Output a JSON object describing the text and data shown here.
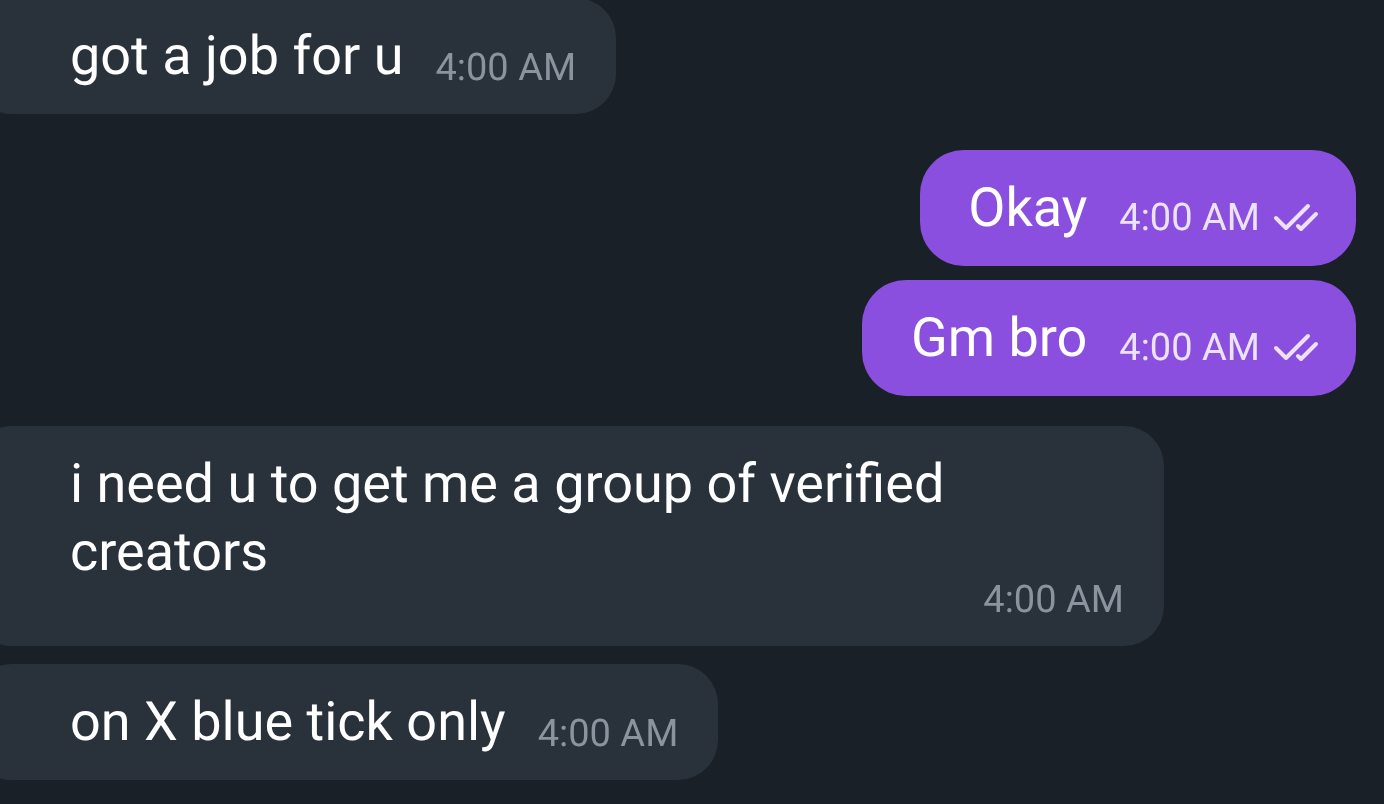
{
  "messages": [
    {
      "kind": "incoming",
      "text": "got a job for u",
      "time": "4:00 AM"
    },
    {
      "kind": "outgoing",
      "text": "Okay",
      "time": "4:00 AM",
      "read": true
    },
    {
      "kind": "outgoing",
      "text": "Gm bro",
      "time": "4:00 AM",
      "read": true
    },
    {
      "kind": "incoming",
      "text": "i need u to get me a group of verified creators",
      "time": "4:00 AM"
    },
    {
      "kind": "incoming",
      "text": "on X blue tick only",
      "time": "4:00 AM"
    }
  ]
}
